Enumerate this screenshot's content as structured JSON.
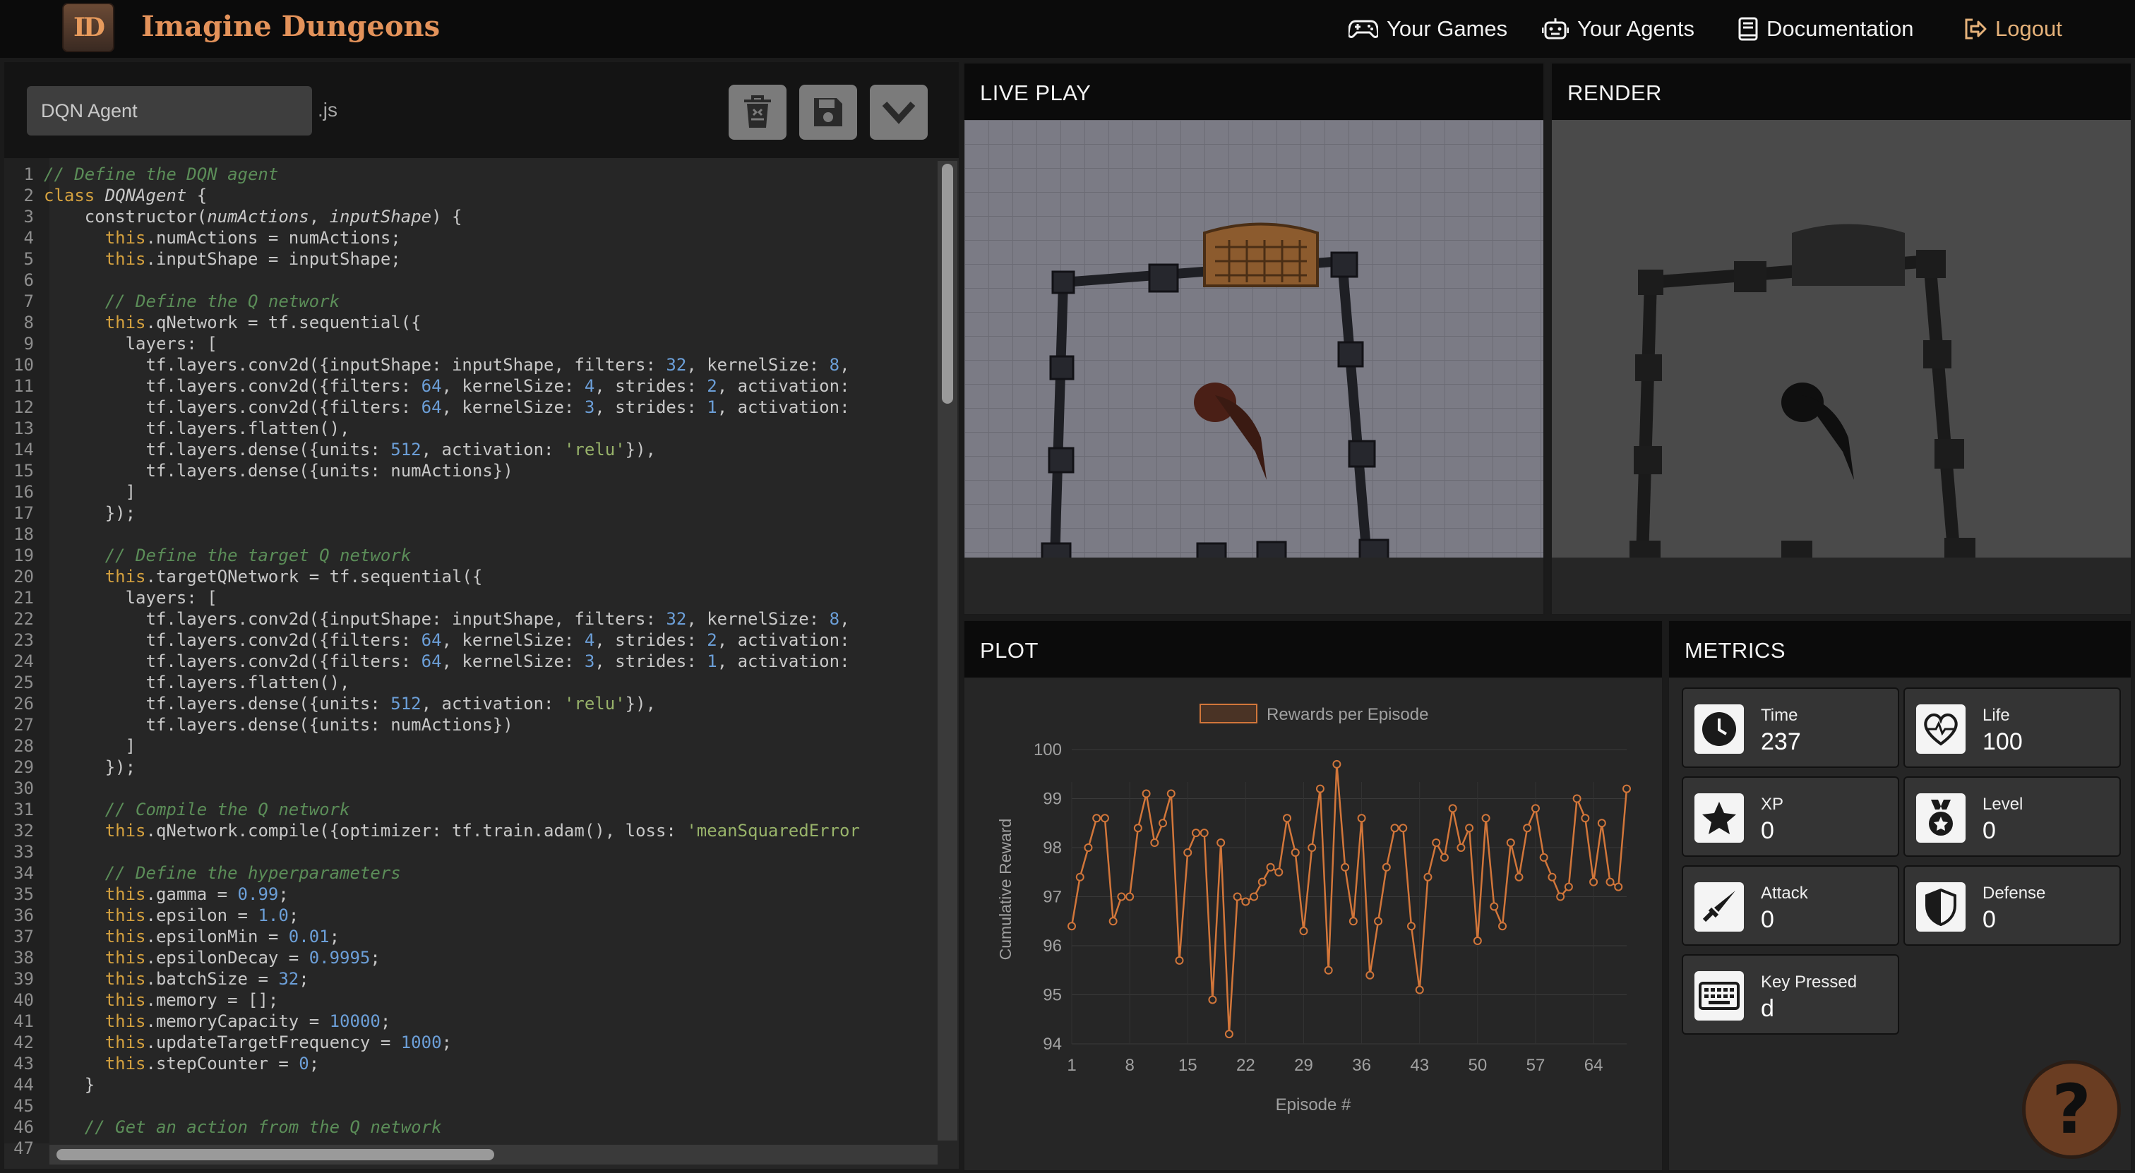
{
  "app": {
    "logo_text": "ID",
    "title": "Imagine Dungeons"
  },
  "nav": {
    "games": "Your Games",
    "agents": "Your Agents",
    "docs": "Documentation",
    "logout": "Logout"
  },
  "editor": {
    "agent_name": "DQN Agent",
    "extension": ".js",
    "buttons": {
      "delete": "trash-can-icon",
      "save": "floppy-disk-icon",
      "collapse": "chevron-down-icon"
    },
    "lines": [
      {
        "n": "1",
        "parts": [
          [
            "c",
            "// Define the DQN agent"
          ]
        ]
      },
      {
        "n": "2",
        "parts": [
          [
            "k",
            "class "
          ],
          [
            "i",
            "DQNAgent"
          ],
          [
            "p",
            " {"
          ]
        ]
      },
      {
        "n": "3",
        "parts": [
          [
            "p",
            "    constructor("
          ],
          [
            "i",
            "numActions"
          ],
          [
            "p",
            ", "
          ],
          [
            "i",
            "inputShape"
          ],
          [
            "p",
            ") {"
          ]
        ]
      },
      {
        "n": "4",
        "parts": [
          [
            "k",
            "      this"
          ],
          [
            "p",
            ".numActions = numActions;"
          ]
        ]
      },
      {
        "n": "5",
        "parts": [
          [
            "k",
            "      this"
          ],
          [
            "p",
            ".inputShape = inputShape;"
          ]
        ]
      },
      {
        "n": "6",
        "parts": []
      },
      {
        "n": "7",
        "parts": [
          [
            "c",
            "      // Define the Q network"
          ]
        ]
      },
      {
        "n": "8",
        "parts": [
          [
            "k",
            "      this"
          ],
          [
            "p",
            ".qNetwork = tf.sequential({"
          ]
        ]
      },
      {
        "n": "9",
        "parts": [
          [
            "p",
            "        layers: ["
          ]
        ]
      },
      {
        "n": "10",
        "parts": [
          [
            "p",
            "          tf.layers.conv2d({inputShape: inputShape, filters: "
          ],
          [
            "n",
            "32"
          ],
          [
            "p",
            ", kernelSize: "
          ],
          [
            "n",
            "8"
          ],
          [
            "p",
            ","
          ]
        ]
      },
      {
        "n": "11",
        "parts": [
          [
            "p",
            "          tf.layers.conv2d({filters: "
          ],
          [
            "n",
            "64"
          ],
          [
            "p",
            ", kernelSize: "
          ],
          [
            "n",
            "4"
          ],
          [
            "p",
            ", strides: "
          ],
          [
            "n",
            "2"
          ],
          [
            "p",
            ", activation:"
          ]
        ]
      },
      {
        "n": "12",
        "parts": [
          [
            "p",
            "          tf.layers.conv2d({filters: "
          ],
          [
            "n",
            "64"
          ],
          [
            "p",
            ", kernelSize: "
          ],
          [
            "n",
            "3"
          ],
          [
            "p",
            ", strides: "
          ],
          [
            "n",
            "1"
          ],
          [
            "p",
            ", activation:"
          ]
        ]
      },
      {
        "n": "13",
        "parts": [
          [
            "p",
            "          tf.layers.flatten(),"
          ]
        ]
      },
      {
        "n": "14",
        "parts": [
          [
            "p",
            "          tf.layers.dense({units: "
          ],
          [
            "n",
            "512"
          ],
          [
            "p",
            ", activation: "
          ],
          [
            "s",
            "'relu'"
          ],
          [
            "p",
            "}),"
          ]
        ]
      },
      {
        "n": "15",
        "parts": [
          [
            "p",
            "          tf.layers.dense({units: numActions})"
          ]
        ]
      },
      {
        "n": "16",
        "parts": [
          [
            "p",
            "        ]"
          ]
        ]
      },
      {
        "n": "17",
        "parts": [
          [
            "p",
            "      });"
          ]
        ]
      },
      {
        "n": "18",
        "parts": []
      },
      {
        "n": "19",
        "parts": [
          [
            "c",
            "      // Define the target Q network"
          ]
        ]
      },
      {
        "n": "20",
        "parts": [
          [
            "k",
            "      this"
          ],
          [
            "p",
            ".targetQNetwork = tf.sequential({"
          ]
        ]
      },
      {
        "n": "21",
        "parts": [
          [
            "p",
            "        layers: ["
          ]
        ]
      },
      {
        "n": "22",
        "parts": [
          [
            "p",
            "          tf.layers.conv2d({inputShape: inputShape, filters: "
          ],
          [
            "n",
            "32"
          ],
          [
            "p",
            ", kernelSize: "
          ],
          [
            "n",
            "8"
          ],
          [
            "p",
            ","
          ]
        ]
      },
      {
        "n": "23",
        "parts": [
          [
            "p",
            "          tf.layers.conv2d({filters: "
          ],
          [
            "n",
            "64"
          ],
          [
            "p",
            ", kernelSize: "
          ],
          [
            "n",
            "4"
          ],
          [
            "p",
            ", strides: "
          ],
          [
            "n",
            "2"
          ],
          [
            "p",
            ", activation:"
          ]
        ]
      },
      {
        "n": "24",
        "parts": [
          [
            "p",
            "          tf.layers.conv2d({filters: "
          ],
          [
            "n",
            "64"
          ],
          [
            "p",
            ", kernelSize: "
          ],
          [
            "n",
            "3"
          ],
          [
            "p",
            ", strides: "
          ],
          [
            "n",
            "1"
          ],
          [
            "p",
            ", activation:"
          ]
        ]
      },
      {
        "n": "25",
        "parts": [
          [
            "p",
            "          tf.layers.flatten(),"
          ]
        ]
      },
      {
        "n": "26",
        "parts": [
          [
            "p",
            "          tf.layers.dense({units: "
          ],
          [
            "n",
            "512"
          ],
          [
            "p",
            ", activation: "
          ],
          [
            "s",
            "'relu'"
          ],
          [
            "p",
            "}),"
          ]
        ]
      },
      {
        "n": "27",
        "parts": [
          [
            "p",
            "          tf.layers.dense({units: numActions})"
          ]
        ]
      },
      {
        "n": "28",
        "parts": [
          [
            "p",
            "        ]"
          ]
        ]
      },
      {
        "n": "29",
        "parts": [
          [
            "p",
            "      });"
          ]
        ]
      },
      {
        "n": "30",
        "parts": []
      },
      {
        "n": "31",
        "parts": [
          [
            "c",
            "      // Compile the Q network"
          ]
        ]
      },
      {
        "n": "32",
        "parts": [
          [
            "k",
            "      this"
          ],
          [
            "p",
            ".qNetwork.compile({optimizer: tf.train.adam(), loss: "
          ],
          [
            "s",
            "'meanSquaredError"
          ]
        ]
      },
      {
        "n": "33",
        "parts": []
      },
      {
        "n": "34",
        "parts": [
          [
            "c",
            "      // Define the hyperparameters"
          ]
        ]
      },
      {
        "n": "35",
        "parts": [
          [
            "k",
            "      this"
          ],
          [
            "p",
            ".gamma = "
          ],
          [
            "n",
            "0.99"
          ],
          [
            "p",
            ";"
          ]
        ]
      },
      {
        "n": "36",
        "parts": [
          [
            "k",
            "      this"
          ],
          [
            "p",
            ".epsilon = "
          ],
          [
            "n",
            "1.0"
          ],
          [
            "p",
            ";"
          ]
        ]
      },
      {
        "n": "37",
        "parts": [
          [
            "k",
            "      this"
          ],
          [
            "p",
            ".epsilonMin = "
          ],
          [
            "n",
            "0.01"
          ],
          [
            "p",
            ";"
          ]
        ]
      },
      {
        "n": "38",
        "parts": [
          [
            "k",
            "      this"
          ],
          [
            "p",
            ".epsilonDecay = "
          ],
          [
            "n",
            "0.9995"
          ],
          [
            "p",
            ";"
          ]
        ]
      },
      {
        "n": "39",
        "parts": [
          [
            "k",
            "      this"
          ],
          [
            "p",
            ".batchSize = "
          ],
          [
            "n",
            "32"
          ],
          [
            "p",
            ";"
          ]
        ]
      },
      {
        "n": "40",
        "parts": [
          [
            "k",
            "      this"
          ],
          [
            "p",
            ".memory = [];"
          ]
        ]
      },
      {
        "n": "41",
        "parts": [
          [
            "k",
            "      this"
          ],
          [
            "p",
            ".memoryCapacity = "
          ],
          [
            "n",
            "10000"
          ],
          [
            "p",
            ";"
          ]
        ]
      },
      {
        "n": "42",
        "parts": [
          [
            "k",
            "      this"
          ],
          [
            "p",
            ".updateTargetFrequency = "
          ],
          [
            "n",
            "1000"
          ],
          [
            "p",
            ";"
          ]
        ]
      },
      {
        "n": "43",
        "parts": [
          [
            "k",
            "      this"
          ],
          [
            "p",
            ".stepCounter = "
          ],
          [
            "n",
            "0"
          ],
          [
            "p",
            ";"
          ]
        ]
      },
      {
        "n": "44",
        "parts": [
          [
            "p",
            "    }"
          ]
        ]
      },
      {
        "n": "45",
        "parts": []
      },
      {
        "n": "46",
        "parts": [
          [
            "c",
            "    // Get an action from the Q network"
          ]
        ]
      },
      {
        "n": "47",
        "parts": []
      }
    ]
  },
  "panels": {
    "live": "LIVE PLAY",
    "render": "RENDER",
    "plot": "PLOT",
    "metrics": "METRICS"
  },
  "chart_data": {
    "type": "line",
    "legend": "Rewards per Episode",
    "xlabel": "Episode #",
    "ylabel": "Cumulative Reward",
    "ylim": [
      94,
      100
    ],
    "yticks": [
      94,
      95,
      96,
      97,
      98,
      99,
      100
    ],
    "xticks": [
      1,
      8,
      15,
      22,
      29,
      36,
      43,
      50,
      57,
      64
    ],
    "color": "#d2763a",
    "x": [
      1,
      2,
      3,
      4,
      5,
      6,
      7,
      8,
      9,
      10,
      11,
      12,
      13,
      14,
      15,
      16,
      17,
      18,
      19,
      20,
      21,
      22,
      23,
      24,
      25,
      26,
      27,
      28,
      29,
      30,
      31,
      32,
      33,
      34,
      35,
      36,
      37,
      38,
      39,
      40,
      41,
      42,
      43,
      44,
      45,
      46,
      47,
      48,
      49,
      50,
      51,
      52,
      53,
      54,
      55,
      56,
      57,
      58,
      59,
      60,
      61,
      62,
      63,
      64,
      65,
      66,
      67,
      68
    ],
    "values": [
      96.4,
      97.4,
      98.0,
      98.6,
      98.6,
      96.5,
      97.0,
      97.0,
      98.4,
      99.1,
      98.1,
      98.5,
      99.1,
      95.7,
      97.9,
      98.3,
      98.3,
      94.9,
      98.1,
      94.2,
      97.0,
      96.9,
      97.0,
      97.3,
      97.6,
      97.5,
      98.6,
      97.9,
      96.3,
      98.0,
      99.2,
      95.5,
      99.7,
      97.6,
      96.5,
      98.6,
      95.4,
      96.5,
      97.6,
      98.4,
      98.4,
      96.4,
      95.1,
      97.4,
      98.1,
      97.8,
      98.8,
      98.0,
      98.4,
      96.1,
      98.6,
      96.8,
      96.4,
      98.1,
      97.4,
      98.4,
      98.8,
      97.8,
      97.4,
      97.0,
      97.2,
      99.0,
      98.6,
      97.3,
      98.5,
      97.3,
      97.2,
      99.2
    ]
  },
  "metrics": [
    {
      "label": "Time",
      "value": "237",
      "icon": "clock-icon"
    },
    {
      "label": "Life",
      "value": "100",
      "icon": "heart-pulse-icon"
    },
    {
      "label": "XP",
      "value": "0",
      "icon": "star-icon"
    },
    {
      "label": "Level",
      "value": "0",
      "icon": "medal-icon"
    },
    {
      "label": "Attack",
      "value": "0",
      "icon": "sword-icon"
    },
    {
      "label": "Defense",
      "value": "0",
      "icon": "shield-icon"
    },
    {
      "label": "Key Pressed",
      "value": "d",
      "icon": "keyboard-icon"
    }
  ],
  "help": {
    "label": "?",
    "icon": "question-mark-icon"
  },
  "colors": {
    "accent": "#e3925a",
    "line": "#d2763a",
    "nav_bg": "#0b0b0b",
    "panel_bg": "#262626"
  }
}
